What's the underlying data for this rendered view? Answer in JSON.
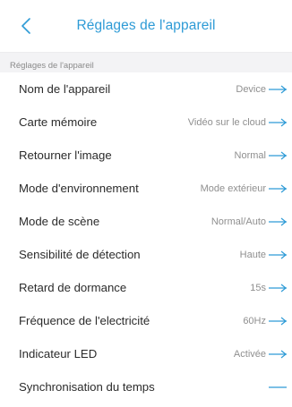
{
  "colors": {
    "accent": "#2e9bd6",
    "section_bg": "#f3f3f5",
    "label": "#2b2b2b",
    "value": "#8f8f8f"
  },
  "header": {
    "back_icon": "chevron-left-icon",
    "title": "Réglages de l'appareil"
  },
  "section": {
    "title": "Réglages de l'appareil"
  },
  "rows": [
    {
      "label": "Nom de l'appareil",
      "value": "Device"
    },
    {
      "label": "Carte mémoire",
      "value": "Vidéo sur le cloud"
    },
    {
      "label": "Retourner l'image",
      "value": "Normal"
    },
    {
      "label": "Mode d'environnement",
      "value": "Mode extérieur"
    },
    {
      "label": "Mode de scène",
      "value": "Normal/Auto"
    },
    {
      "label": "Sensibilité de détection",
      "value": "Haute"
    },
    {
      "label": "Retard de dormance",
      "value": "15s"
    },
    {
      "label": "Fréquence de l'electricité",
      "value": "60Hz"
    },
    {
      "label": "Indicateur LED",
      "value": "Activée"
    },
    {
      "label": "Synchronisation du temps",
      "value": ""
    }
  ]
}
